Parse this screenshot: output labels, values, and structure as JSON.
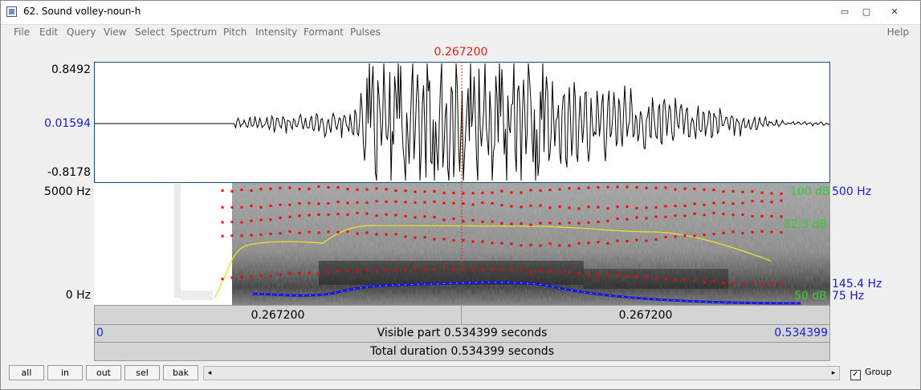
{
  "window": {
    "title": "62. Sound volley-noun-h",
    "controls": [
      "▭",
      "▢",
      "✕"
    ]
  },
  "menu": [
    "File",
    "Edit",
    "Query",
    "View",
    "Select",
    "Spectrum",
    "Pitch",
    "Intensity",
    "Formant",
    "Pulses"
  ],
  "help": "Help",
  "cursor": {
    "time_label": "0.267200",
    "time": 0.2672
  },
  "waveform": {
    "max": "0.8492",
    "zero": "0.01594",
    "min": "-0.8178"
  },
  "spectrogram": {
    "top_freq": "5000 Hz",
    "bottom_freq": "0 Hz",
    "intensity_max": "100 dB",
    "intensity_mid": "82.3 dB",
    "intensity_min": "50 dB",
    "pitch_top": "500 Hz",
    "pitch_current": "145.4 Hz",
    "pitch_bottom": "75 Hz"
  },
  "time_bar": {
    "left": "0.267200",
    "right": "0.267200"
  },
  "visible": {
    "start": "0",
    "label": "Visible part 0.534399 seconds",
    "end": "0.534399"
  },
  "total": {
    "label": "Total duration 0.534399 seconds"
  },
  "buttons": {
    "all": "all",
    "in": "in",
    "out": "out",
    "sel": "sel",
    "bak": "bak"
  },
  "scroll_arrows": {
    "left": "◂",
    "right": "▸"
  },
  "group": {
    "label": "Group",
    "checked": true,
    "mark": "✓"
  },
  "colors": {
    "cursor": "#e0201a",
    "zero_label": "#1a1ad0",
    "intensity": "#33cc33",
    "pitch": "#1a1ad0",
    "formant": "#ff0000"
  }
}
